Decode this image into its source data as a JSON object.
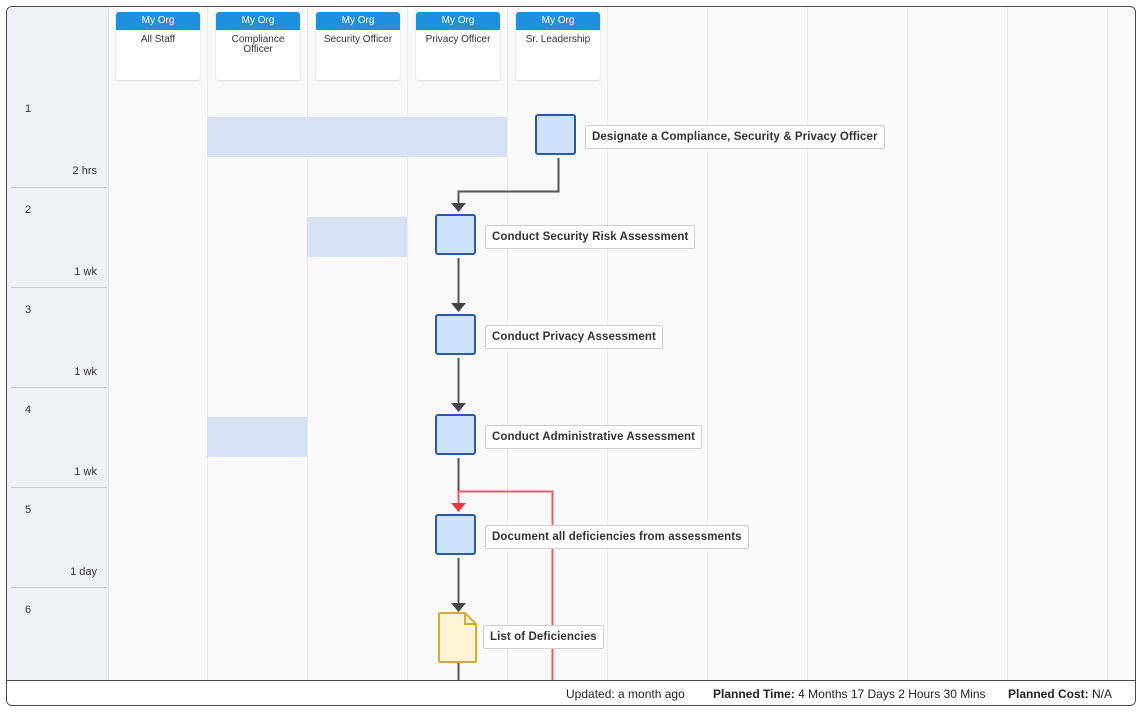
{
  "lanes": [
    {
      "org": "My Org",
      "title": "All Staff"
    },
    {
      "org": "My Org",
      "title": "Compliance Officer"
    },
    {
      "org": "My Org",
      "title": "Security Officer"
    },
    {
      "org": "My Org",
      "title": "Privacy Officer"
    },
    {
      "org": "My Org",
      "title": "Sr. Leadership"
    }
  ],
  "rows": [
    {
      "number": "1",
      "duration": "2 hrs"
    },
    {
      "number": "2",
      "duration": "1 wk"
    },
    {
      "number": "3",
      "duration": "1 wk"
    },
    {
      "number": "4",
      "duration": "1 wk"
    },
    {
      "number": "5",
      "duration": "1 day"
    },
    {
      "number": "6",
      "duration": ""
    }
  ],
  "steps": [
    {
      "label": "Designate a Compliance, Security & Privacy Officer",
      "type": "task"
    },
    {
      "label": "Conduct Security Risk Assessment",
      "type": "task"
    },
    {
      "label": "Conduct Privacy Assessment",
      "type": "task"
    },
    {
      "label": "Conduct Administrative Assessment",
      "type": "task"
    },
    {
      "label": "Document all deficiencies from assessments",
      "type": "task"
    },
    {
      "label": "List of Deficiencies",
      "type": "document"
    }
  ],
  "colors": {
    "lane_header": "#1e90e0",
    "task_fill": "#cfe2fb",
    "task_border": "#2b57a3",
    "document_fill": "#fff4d4",
    "document_border": "#d4aa3a",
    "participant_band": "#d6e1f3",
    "connector": "#555555",
    "loop_connector": "#e35d6a"
  },
  "footer": {
    "updated": "Updated: a month ago",
    "planned_time_label": "Planned Time:",
    "planned_time_value": "4 Months 17 Days 2 Hours 30 Mins",
    "planned_cost_label": "Planned Cost:",
    "planned_cost_value": "N/A"
  }
}
